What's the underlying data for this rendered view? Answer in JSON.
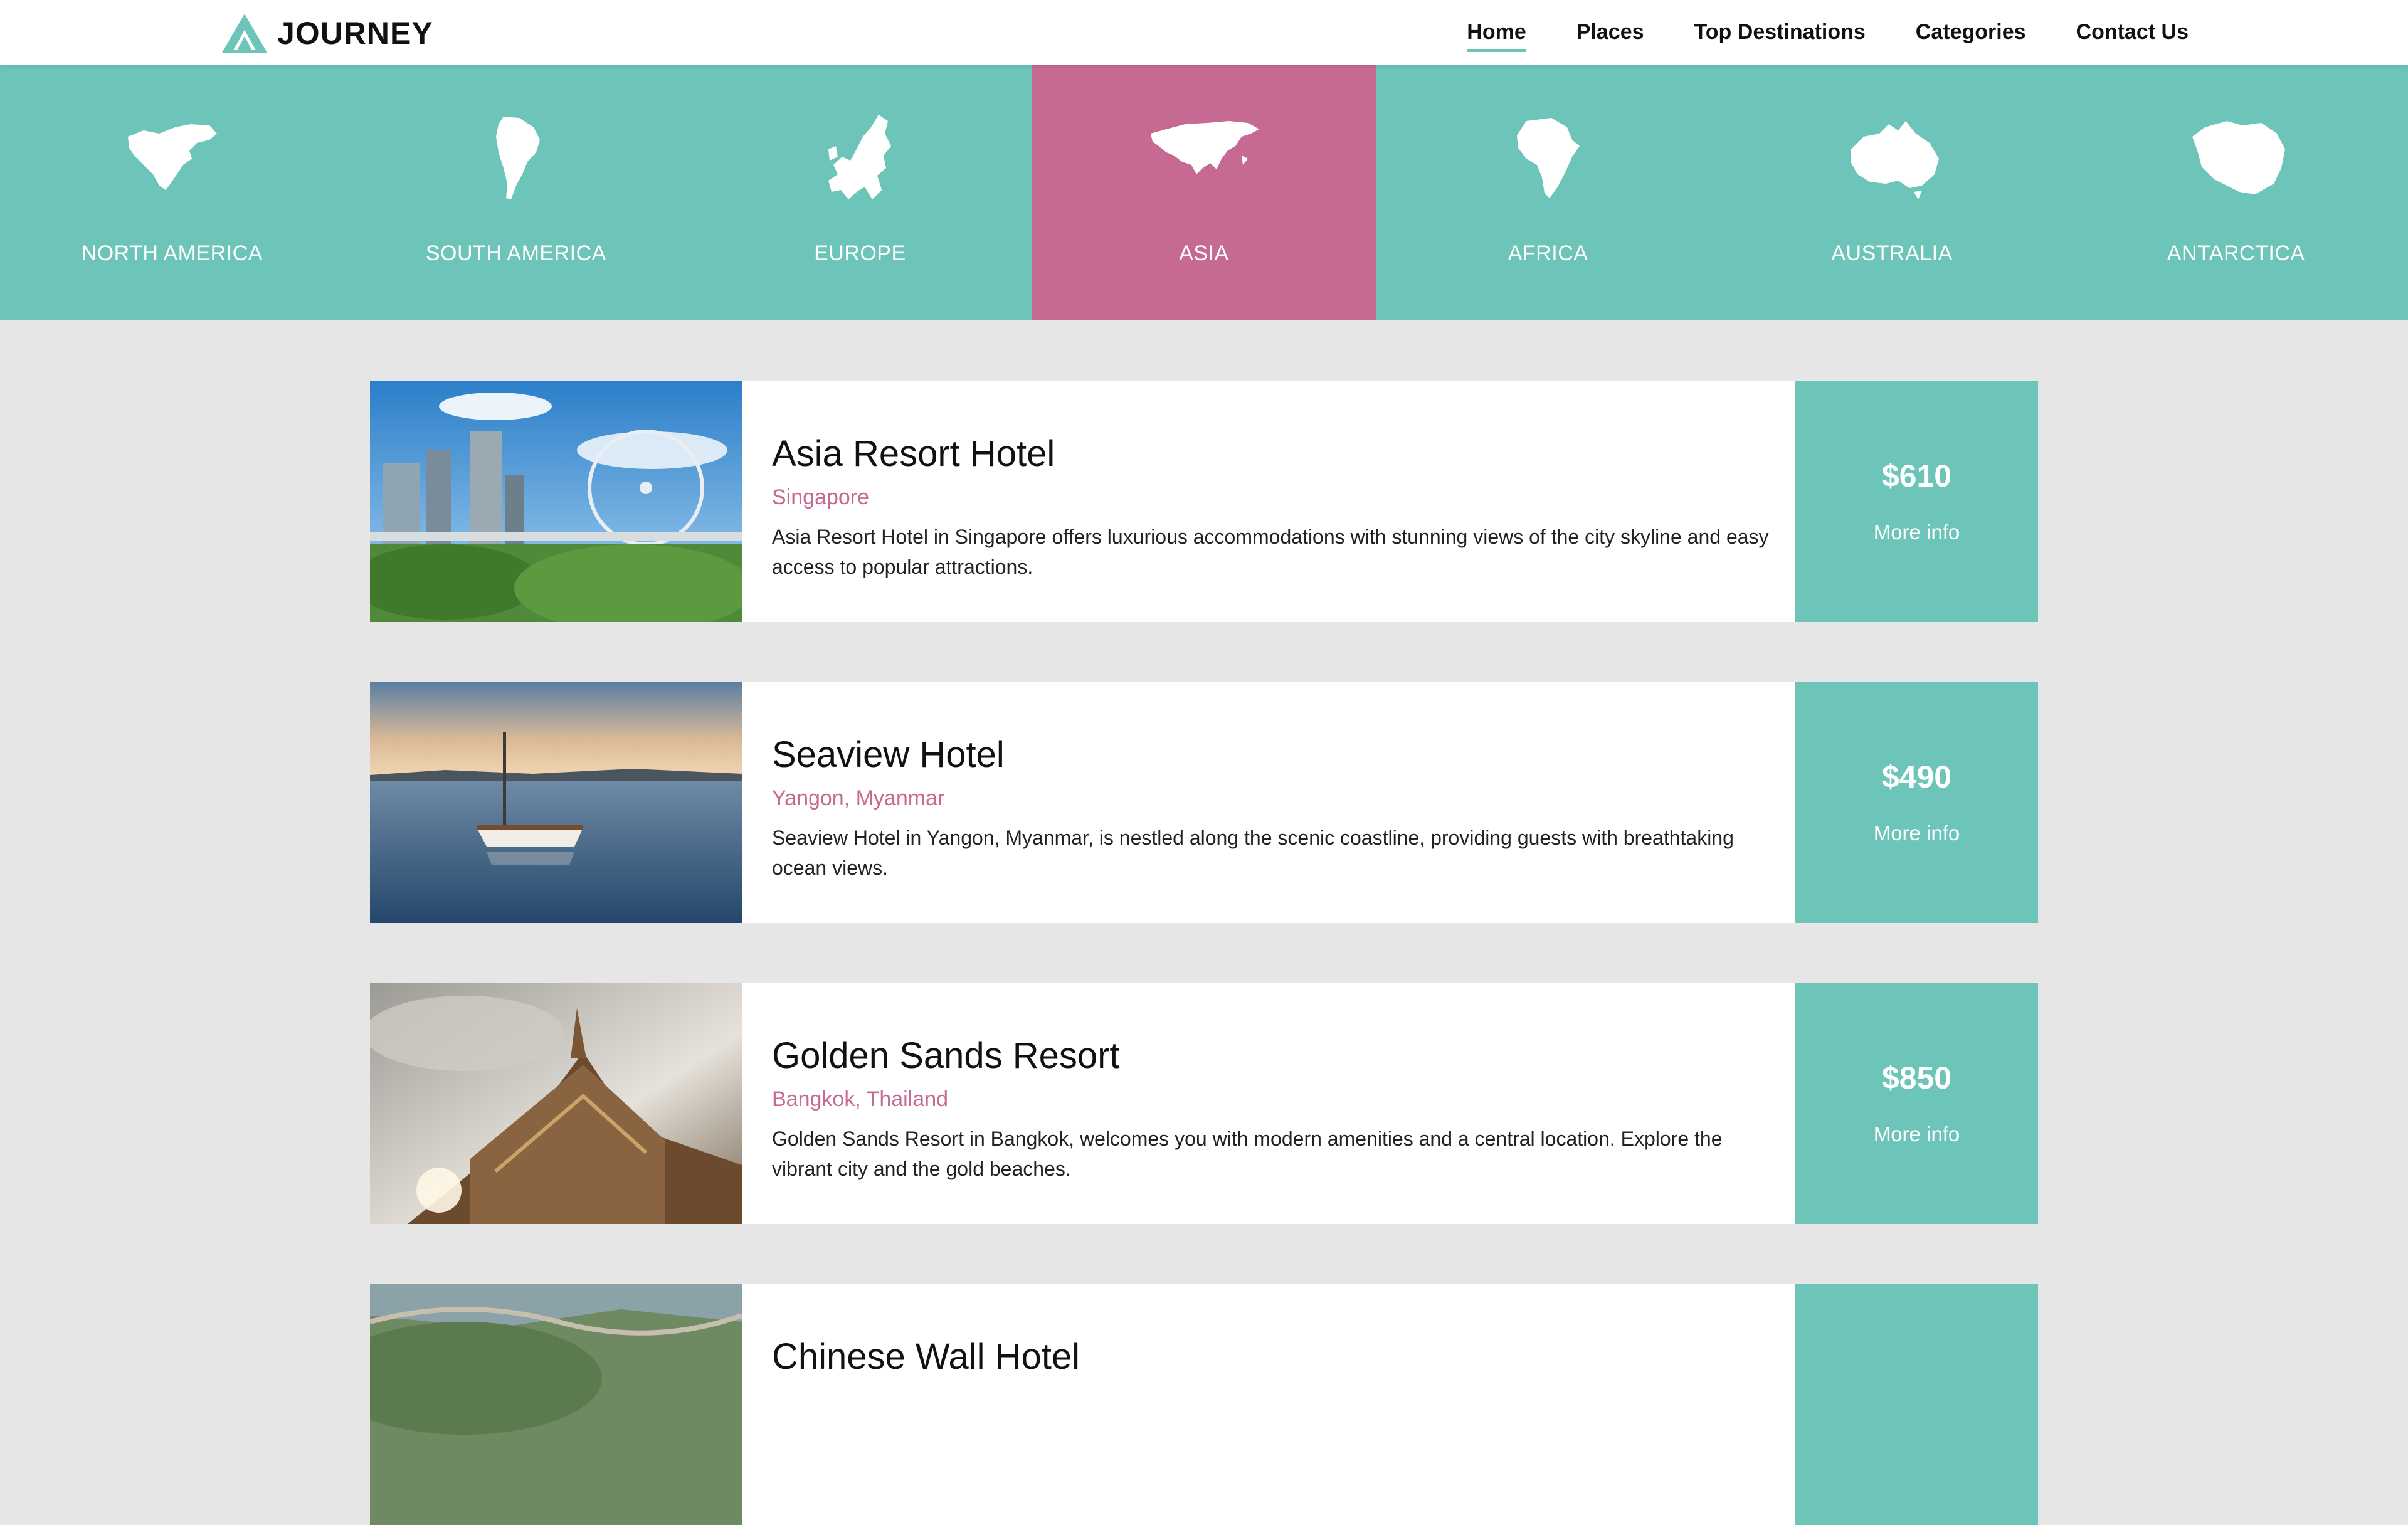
{
  "header": {
    "logo_text": "JOURNEY",
    "nav": [
      "Home",
      "Places",
      "Top Destinations",
      "Categories",
      "Contact Us"
    ],
    "active_nav": "Home"
  },
  "continents": [
    {
      "label": "NORTH AMERICA",
      "icon": "north-america-icon"
    },
    {
      "label": "SOUTH AMERICA",
      "icon": "south-america-icon"
    },
    {
      "label": "EUROPE",
      "icon": "europe-icon"
    },
    {
      "label": "ASIA",
      "icon": "asia-icon",
      "selected": true
    },
    {
      "label": "AFRICA",
      "icon": "africa-icon"
    },
    {
      "label": "AUSTRALIA",
      "icon": "australia-icon"
    },
    {
      "label": "ANTARCTICA",
      "icon": "antarctica-icon"
    }
  ],
  "listings": [
    {
      "title": "Asia Resort Hotel",
      "location": "Singapore",
      "description": "Asia Resort Hotel in Singapore offers luxurious accommodations with stunning views of the city skyline and easy access to popular attractions.",
      "price": "$610",
      "more": "More info"
    },
    {
      "title": "Seaview Hotel",
      "location": "Yangon, Myanmar",
      "description": "Seaview Hotel in Yangon, Myanmar, is nestled along the scenic coastline, providing guests with breathtaking ocean views.",
      "price": "$490",
      "more": "More info"
    },
    {
      "title": "Golden Sands Resort",
      "location": "Bangkok, Thailand",
      "description": "Golden Sands Resort in Bangkok, welcomes you with modern amenities and a central location. Explore the vibrant city and the gold beaches.",
      "price": "$850",
      "more": "More info"
    },
    {
      "title": "Chinese Wall Hotel",
      "location": "",
      "description": "",
      "price": "",
      "more": ""
    }
  ],
  "colors": {
    "teal": "#6cc5b8",
    "pink": "#c66a93",
    "background": "#e6e6e6"
  }
}
